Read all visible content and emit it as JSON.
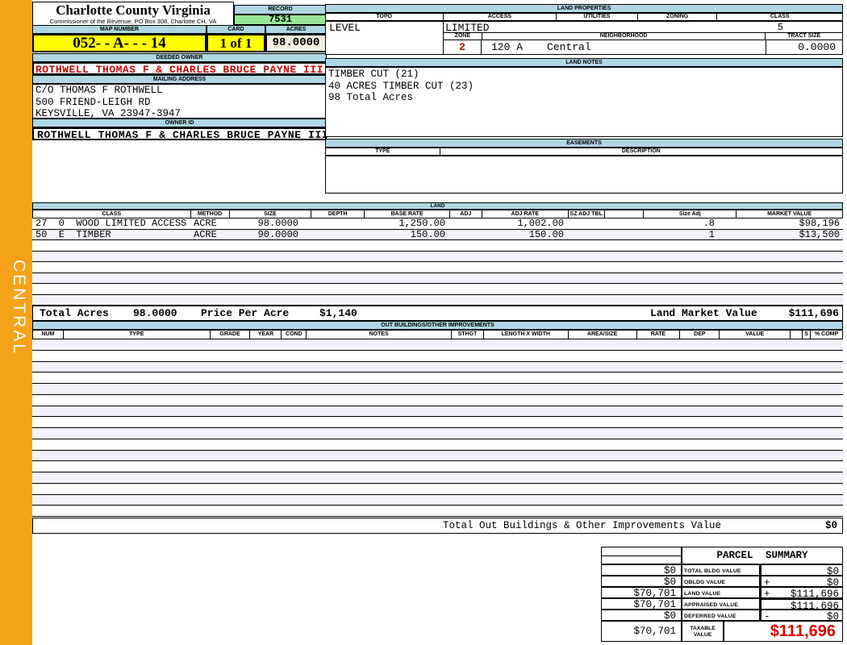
{
  "sidebar": {
    "label": "CENTRAL"
  },
  "header": {
    "county": "Charlotte County Virginia",
    "office": "Commissioner of the Revenue, PO Box 308, Charlotte CH, VA",
    "record_label": "RECORD",
    "record": "7531",
    "map_number_label": "MAP NUMBER",
    "map_number": "052- - A-  -  - 14",
    "card_label": "CARD",
    "card": "1 of 1",
    "acres_label": "ACRES",
    "acres": "98.0000"
  },
  "owner": {
    "deeded_owner_label": "DEEDED OWNER",
    "deeded_owner": "ROTHWELL THOMAS F & CHARLES BRUCE PAYNE III",
    "mailing_label": "MAILING ADDRESS",
    "mailing_lines": [
      "C/O THOMAS F ROTHWELL",
      "500 FRIEND-LEIGH RD",
      "KEYSVILLE, VA 23947-3947"
    ],
    "owner_id_label": "OWNER ID",
    "owner_id": "ROTHWELL THOMAS F & CHARLES BRUCE PAYNE III"
  },
  "land_properties": {
    "title": "LAND PROPERTIES",
    "headers": [
      "TOPO",
      "ACCESS",
      "UTILITIES",
      "ZONING",
      "CLASS"
    ],
    "topo": "LEVEL",
    "access": "LIMITED",
    "utilities": "",
    "zoning": "",
    "class": "5",
    "zone_label": "ZONE",
    "zone": "2",
    "zone_code": "120 A",
    "neighborhood_label": "NEIGHBORHOOD",
    "neighborhood": "Central",
    "tract_size_label": "TRACT SIZE",
    "tract_size": "0.0000"
  },
  "land_notes": {
    "title": "LAND NOTES",
    "lines": [
      "TIMBER CUT (21)",
      "40 ACRES TIMBER CUT (23)",
      "98 Total Acres"
    ]
  },
  "easements": {
    "title": "EASEMENTS",
    "type_label": "TYPE",
    "description_label": "DESCRIPTION"
  },
  "land_table": {
    "title": "LAND",
    "columns": [
      "CLASS",
      "METHOD",
      "SIZE",
      "DEPTH",
      "BASE RATE",
      "ADJ",
      "ADJ RATE",
      "SZ ADJ TBL",
      "",
      "Size Adj",
      "MARKET VALUE"
    ],
    "rows": [
      {
        "class": "27  0  WOOD LIMITED ACCESS",
        "method": "ACRE",
        "size": "98.0000",
        "depth": "",
        "base_rate": "1,250.00",
        "adj": "",
        "adj_rate": "1,002.00",
        "sz_adj_tbl": "",
        "size_adj": ".8",
        "market_value": "$98,196"
      },
      {
        "class": "50  E  TIMBER",
        "method": "ACRE",
        "size": "90.0000",
        "depth": "",
        "base_rate": "150.00",
        "adj": "",
        "adj_rate": "150.00",
        "sz_adj_tbl": "",
        "size_adj": "1",
        "market_value": "$13,500"
      }
    ],
    "empty_row_count": 6,
    "totals": {
      "total_acres_label": "Total Acres",
      "total_acres": "98.0000",
      "price_per_acre_label": "Price Per Acre",
      "price_per_acre": "$1,140",
      "land_market_value_label": "Land Market Value",
      "land_market_value": "$111,696"
    }
  },
  "out_buildings": {
    "title": "OUT BUILDINGS/OTHER IMPROVEMENTS",
    "columns": [
      "NUM",
      "TYPE",
      "GRADE",
      "YEAR",
      "COND",
      "NOTES",
      "STHGT",
      "LENGTH X WIDTH",
      "AREA/SIZE",
      "RATE",
      "DEP",
      "VALUE",
      "",
      "S",
      "% COMP"
    ],
    "empty_row_count": 16,
    "total_label": "Total Out Buildings & Other Improvements Value",
    "total_value": "$0"
  },
  "parcel_summary": {
    "title": "PARCEL SUMMARY",
    "rows": [
      {
        "prior": "$0",
        "label": "TOTAL BLDG VALUE",
        "op": "",
        "value": "$0"
      },
      {
        "prior": "$0",
        "label": "OBLDG VALUE",
        "op": "+",
        "value": "$0"
      },
      {
        "prior": "$70,701",
        "label": "LAND VALUE",
        "op": "+",
        "value": "$111,696"
      },
      {
        "prior": "$70,701",
        "label": "APPRAISED VALUE",
        "op": "",
        "value": "$111,696"
      },
      {
        "prior": "$0",
        "label": "DEFERRED VALUE",
        "op": "-",
        "value": "$0"
      }
    ],
    "taxable": {
      "prior": "$70,701",
      "label_line1": "TAXABLE",
      "label_line2": "VALUE",
      "value": "$111,696"
    }
  },
  "colors": {
    "sidebar_orange": "#F7A21B",
    "header_blue": "#AFD6E4",
    "record_green": "#98E698",
    "highlight_yellow": "#FFFF00",
    "acres_cream": "#F0EFE0",
    "alert_red": "#CC0000",
    "taxable_red": "#DD0000",
    "row_stripe": "#F2F2FA"
  }
}
